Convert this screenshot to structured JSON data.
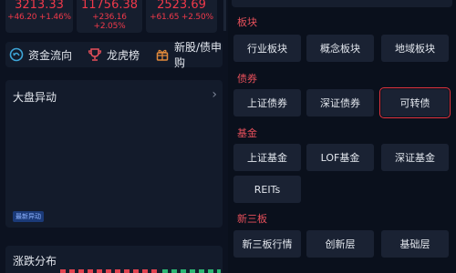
{
  "indices": [
    {
      "value": "3213.33",
      "change": "+46.20 +1.46%"
    },
    {
      "value": "11756.38",
      "change": "+236.16 +2.05%"
    },
    {
      "value": "2523.69",
      "change": "+61.65 +2.50%"
    }
  ],
  "quick_links": [
    {
      "label": "资金流向",
      "icon": "fund-flow-icon"
    },
    {
      "label": "龙虎榜",
      "icon": "trophy-icon"
    },
    {
      "label": "新股/债申购",
      "icon": "ipo-icon"
    }
  ],
  "market_move": {
    "title": "大盘异动",
    "badge": "最新异动"
  },
  "rise_fall": {
    "title": "涨跌分布"
  },
  "sections": {
    "board": {
      "label": "板块",
      "buttons": [
        "行业板块",
        "概念板块",
        "地域板块"
      ]
    },
    "bond": {
      "label": "债券",
      "buttons": [
        "上证债券",
        "深证债券",
        "可转债"
      ]
    },
    "fund": {
      "label": "基金",
      "buttons": [
        "上证基金",
        "LOF基金",
        "深证基金",
        "REITs"
      ]
    },
    "neeq": {
      "label": "新三板",
      "buttons": [
        "新三板行情",
        "创新层",
        "基础层"
      ]
    }
  },
  "colors": {
    "accent_red": "#e8505b",
    "highlight": "#e3343f"
  }
}
